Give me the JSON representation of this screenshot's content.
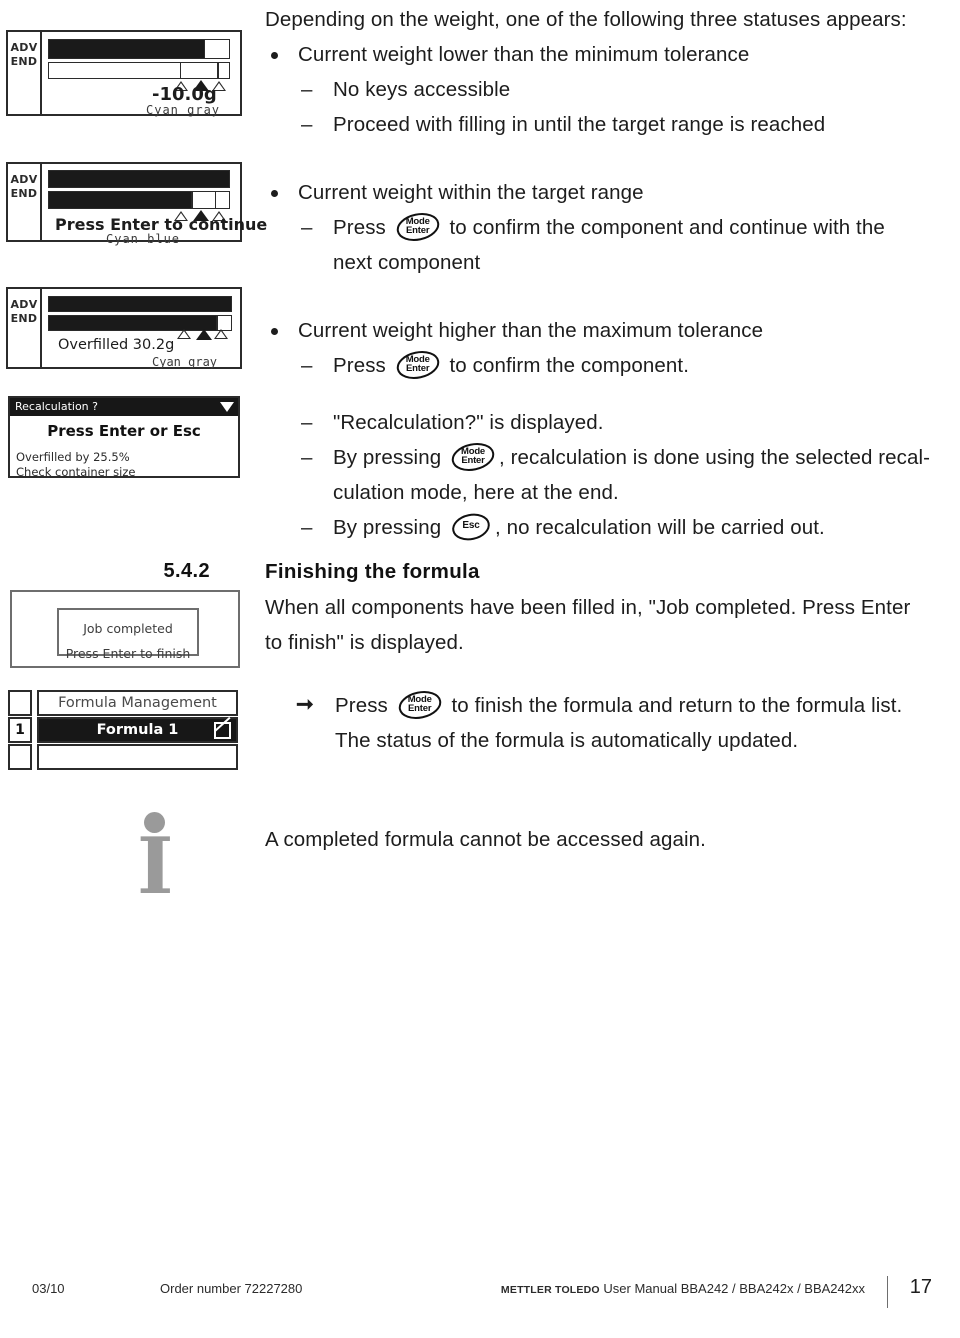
{
  "intro": {
    "lead": "Depending on the weight, one of the following three statuses appears:"
  },
  "status_low": {
    "bullet": "Current weight lower than the minimum tolerance",
    "sub1": "No keys accessible",
    "sub2": "Proceed with filling in until the target range is reached"
  },
  "status_ok": {
    "bullet": "Current weight within the target range",
    "sub1_pre": "Press",
    "sub1_post": "to confirm the component and continue with the",
    "sub1_cont": "next component"
  },
  "status_high": {
    "bullet": "Current weight higher than the maximum tolerance",
    "sub1_pre": "Press",
    "sub1_post": "to confirm the component.",
    "sub2": "\"Recalculation?\" is displayed.",
    "sub3_pre": "By pressing",
    "sub3_post": ", recalculation is done using the selected recal-",
    "sub3_cont": "culation mode, here at the end.",
    "sub4_pre": "By pressing",
    "sub4_post": ", no recalculation will be carried out."
  },
  "section": {
    "number": "5.4.2",
    "heading": "Finishing the formula",
    "para_line1": "When all components have been filled in, \"Job completed. Press Enter",
    "para_line2": "to finish\" is displayed.",
    "action_pre": "Press",
    "action_post": "to finish the formula and return to the formula list.",
    "action_line2": "The status of the formula is automatically updated."
  },
  "note": {
    "text": "A completed formula cannot be accessed again.",
    "icon": "info-icon",
    "icon_color": "#9a9a9a"
  },
  "keys": {
    "mode_top": "Mode",
    "mode_bottom": "Enter",
    "esc": "Esc"
  },
  "figures": {
    "display_under": {
      "side_line1": "ADV",
      "side_line2": "END",
      "weight": "-10.0g",
      "caption": "Cyan gray",
      "bar_top_fill_pct": 88,
      "bar_bottom_fill_pct": 0
    },
    "display_ok": {
      "side_line1": "ADV",
      "side_line2": "END",
      "message": "Press Enter to continue",
      "caption": "Cyan blue",
      "bar_top_fill_pct": 100,
      "bar_bottom_fill_pct": 80
    },
    "display_over": {
      "side_line1": "ADV",
      "side_line2": "END",
      "message": "Overfilled  30.2g",
      "caption": "Cyan gray",
      "bar_top_fill_pct": 100,
      "bar_bottom_fill_pct": 94
    },
    "recalc_dialog": {
      "title": "Recalculation ?",
      "main": "Press Enter or Esc",
      "line1": "Overfilled by 25.5%",
      "line2": "Check container size",
      "caret_icon": "chevron-down-icon"
    },
    "job_box": {
      "line1": "Job completed",
      "line2": "Press Enter to finish"
    },
    "formula_list": {
      "header_label": "Formula Management",
      "header_num": "",
      "rows": [
        {
          "num": "1",
          "label": "Formula 1",
          "selected": true,
          "check_icon": "checkbox-slash-icon"
        },
        {
          "num": "",
          "label": "",
          "selected": false
        }
      ]
    }
  },
  "footer": {
    "date": "03/10",
    "order": "Order number 72227280",
    "brand": "METTLER TOLEDO",
    "manual": "User Manual BBA242 / BBA242x / BBA242xx",
    "page": "17"
  }
}
